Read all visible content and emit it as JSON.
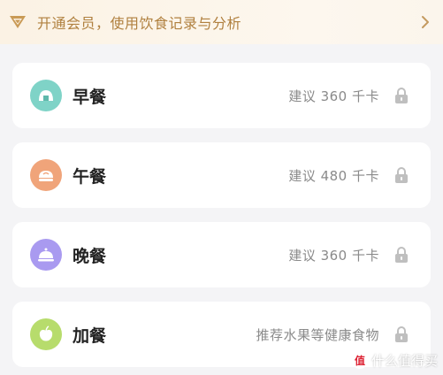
{
  "banner": {
    "text": "开通会员，使用饮食记录与分析",
    "accent": "#b0803f"
  },
  "meals": [
    {
      "name": "早餐",
      "hint": "建议 360 千卡",
      "icon": "rice-ball-icon",
      "color": "#7fd3c7"
    },
    {
      "name": "午餐",
      "hint": "建议 480 千卡",
      "icon": "bun-icon",
      "color": "#f0a47a"
    },
    {
      "name": "晚餐",
      "hint": "建议 360 千卡",
      "icon": "cloche-icon",
      "color": "#a99af0"
    },
    {
      "name": "加餐",
      "hint": "推荐水果等健康食物",
      "icon": "apple-icon",
      "color": "#b7dc6c"
    }
  ],
  "watermark": {
    "text": "什么值得买",
    "icon_text": "值"
  }
}
